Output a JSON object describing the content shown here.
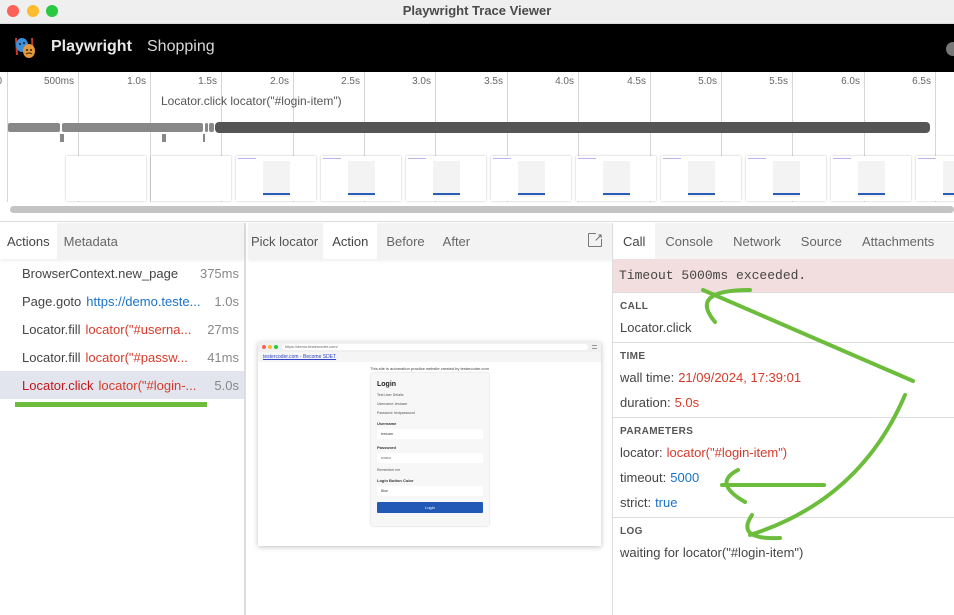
{
  "window": {
    "title": "Playwright Trace Viewer"
  },
  "header": {
    "brand": "Playwright",
    "title": "Shopping"
  },
  "timeline": {
    "ticks": [
      "0",
      "500ms",
      "1.0s",
      "1.5s",
      "2.0s",
      "2.5s",
      "3.0s",
      "3.5s",
      "4.0s",
      "4.5s",
      "5.0s",
      "5.5s",
      "6.0s",
      "6.5s"
    ],
    "hover_label": "Locator.click locator(\"#login-item\")"
  },
  "actions_panel": {
    "tabs": [
      "Actions",
      "Metadata"
    ],
    "items": [
      {
        "name": "BrowserContext.new_page",
        "param": "",
        "duration": "375ms"
      },
      {
        "name": "Page.goto",
        "param": "https://demo.teste...",
        "duration": "1.0s"
      },
      {
        "name": "Locator.fill",
        "param": "locator(\"#userna...",
        "duration": "27ms"
      },
      {
        "name": "Locator.fill",
        "param": "locator(\"#passw...",
        "duration": "41ms"
      },
      {
        "name": "Locator.click",
        "param": "locator(\"#login-...",
        "duration": "5.0s"
      }
    ]
  },
  "snapshot_panel": {
    "pick_locator": "Pick locator",
    "tabs": [
      "Action",
      "Before",
      "After"
    ],
    "snapshot": {
      "url": "https://demo.testercoder.com/",
      "nav_link": "testercoder.com - Become SDET",
      "intro": "This site is automation practice website created by testercoder.com",
      "heading": "Login",
      "details_title": "Test User Details",
      "details_username": "Username:  testuser",
      "details_password": "Password:  testpassword",
      "username_label": "Username",
      "username_value": "testuser",
      "password_label": "Password",
      "password_value": "••••••••",
      "remember": "Remember me",
      "color_label": "Login Button Color",
      "color_value": "Blue",
      "button": "Login"
    }
  },
  "details_panel": {
    "tabs": [
      "Call",
      "Console",
      "Network",
      "Source",
      "Attachments"
    ],
    "error": "Timeout 5000ms exceeded.",
    "call_title": "CALL",
    "call_value": "Locator.click",
    "time_title": "TIME",
    "wall_time_label": "wall time:",
    "wall_time": "21/09/2024, 17:39:01",
    "duration_label": "duration:",
    "duration": "5.0s",
    "params_title": "PARAMETERS",
    "locator_label": "locator:",
    "locator": "locator(\"#login-item\")",
    "timeout_label": "timeout:",
    "timeout": "5000",
    "strict_label": "strict:",
    "strict": "true",
    "log_title": "LOG",
    "log": "waiting for locator(\"#login-item\")"
  },
  "colors": {
    "accent_green": "#6cbd3c",
    "error_bg": "#f2dede",
    "value_red": "#d53b2a",
    "value_blue": "#1a73c7"
  }
}
